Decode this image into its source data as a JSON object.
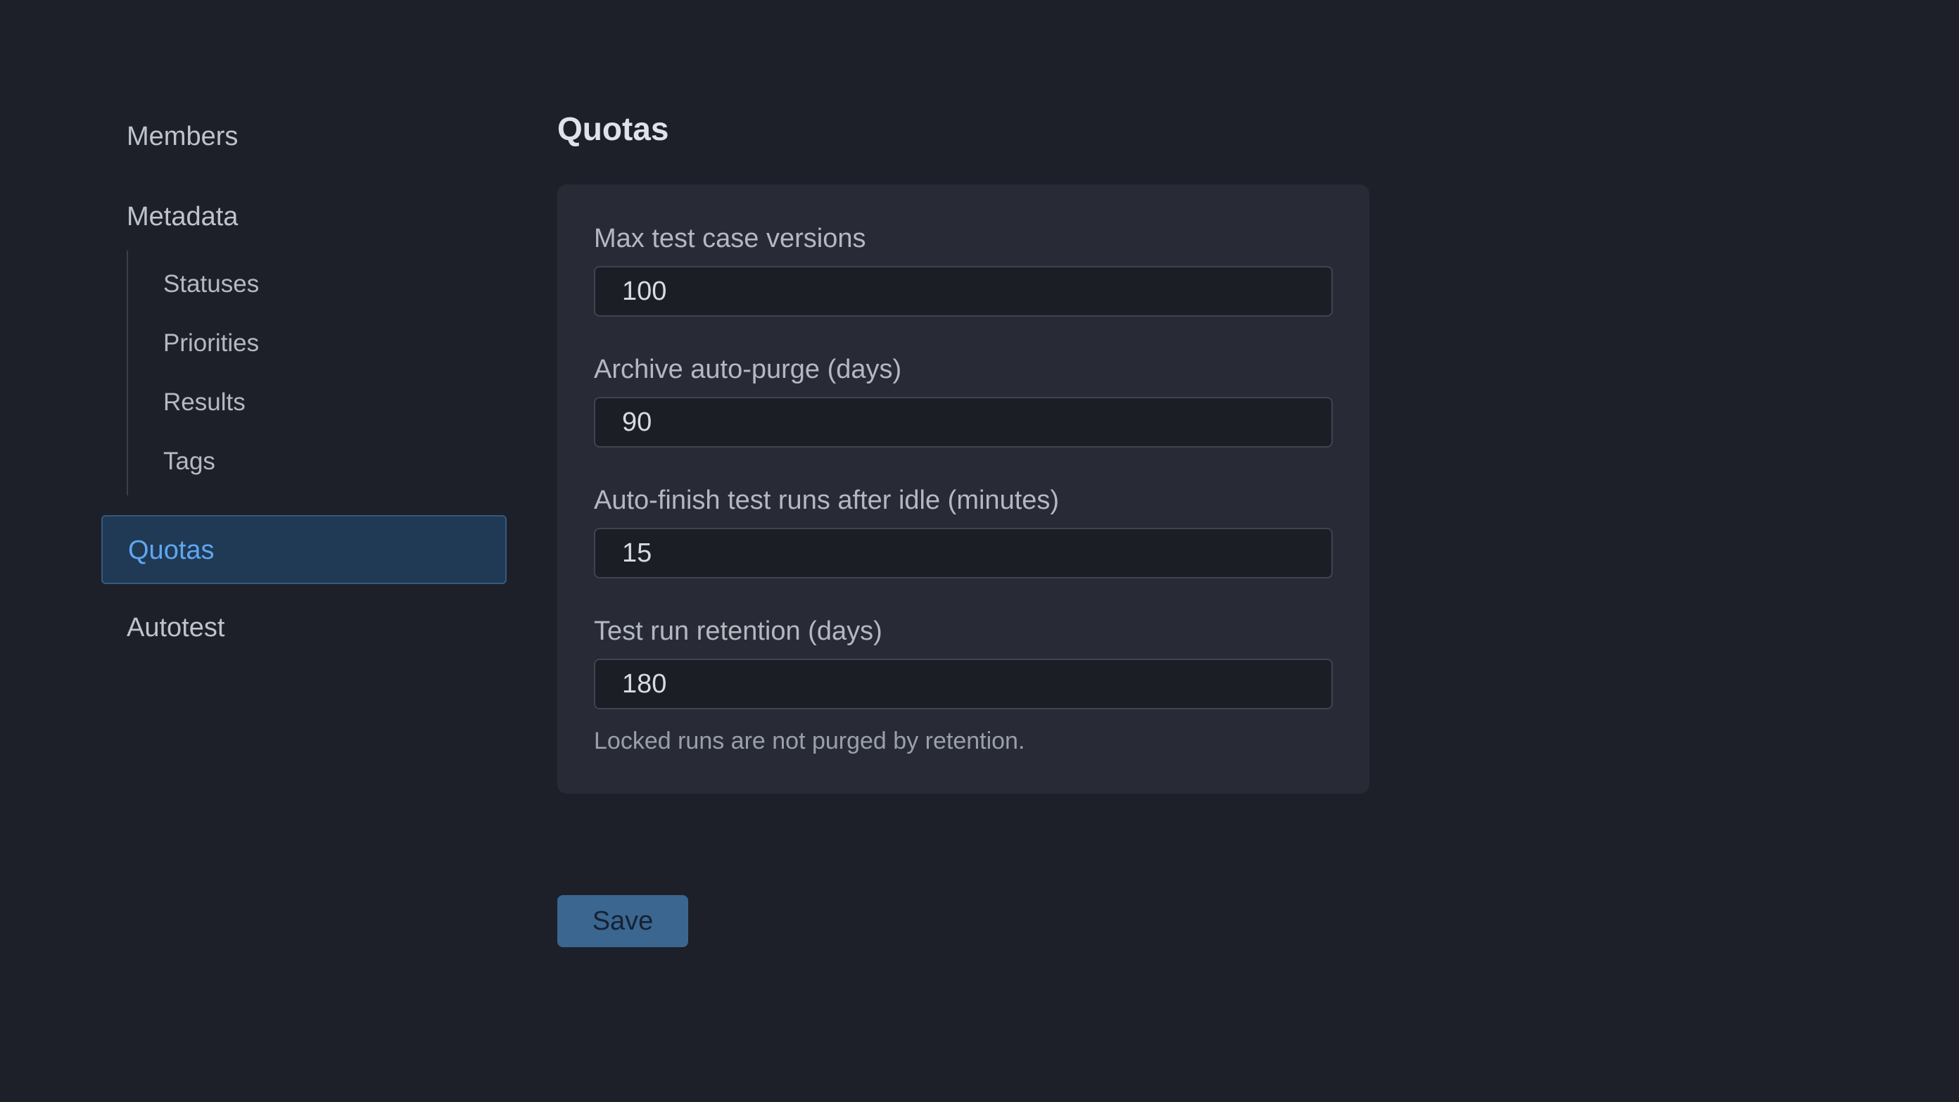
{
  "sidebar": {
    "members": "Members",
    "metadata": "Metadata",
    "metadata_items": [
      "Statuses",
      "Priorities",
      "Results",
      "Tags"
    ],
    "quotas": "Quotas",
    "autotest": "Autotest"
  },
  "main": {
    "title": "Quotas",
    "fields": [
      {
        "label": "Max test case versions",
        "value": "100"
      },
      {
        "label": "Archive auto-purge (days)",
        "value": "90"
      },
      {
        "label": "Auto-finish test runs after idle (minutes)",
        "value": "15"
      },
      {
        "label": "Test run retention (days)",
        "value": "180"
      }
    ],
    "help_text": "Locked runs are not purged by retention.",
    "save_label": "Save"
  },
  "colors": {
    "background": "#1d2029",
    "card": "#282b35",
    "active_nav_bg": "#203955",
    "active_nav_text": "#5fa7ef",
    "save_button": "#3b6690"
  }
}
